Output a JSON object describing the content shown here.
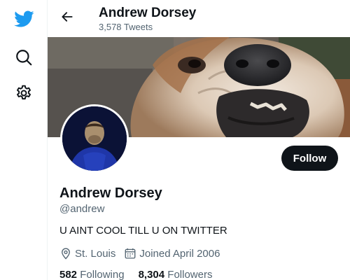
{
  "nav": {
    "items": [
      {
        "icon": "twitter-bird-icon"
      },
      {
        "icon": "search-icon"
      },
      {
        "icon": "gear-icon"
      }
    ],
    "brand_color": "#1d9bf0"
  },
  "header": {
    "name": "Andrew Dorsey",
    "tweet_count": "3,578 Tweets"
  },
  "profile": {
    "display_name": "Andrew Dorsey",
    "handle": "@andrew",
    "bio": "U AINT COOL TILL U ON TWITTER",
    "location": "St. Louis",
    "joined": "Joined April 2006",
    "follow_label": "Follow",
    "following_count": "582",
    "following_label": "Following",
    "followers_count": "8,304",
    "followers_label": "Followers"
  },
  "colors": {
    "text_primary": "#0f1419",
    "text_secondary": "#536471",
    "follow_button_bg": "#0f1419"
  }
}
